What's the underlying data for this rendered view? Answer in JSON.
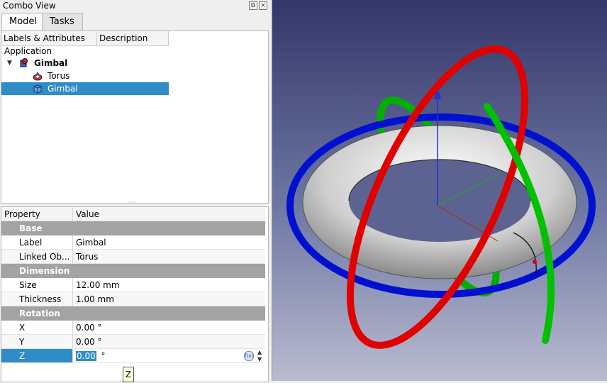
{
  "combo": {
    "title": "Combo View"
  },
  "tabs": [
    {
      "label": "Model"
    },
    {
      "label": "Tasks"
    }
  ],
  "tree": {
    "headers": {
      "labels": "Labels & Attributes",
      "description": "Description"
    },
    "application": "Application",
    "items": [
      {
        "label": "Gimbal",
        "icon": "part-icon"
      },
      {
        "label": "Torus",
        "icon": "torus-icon"
      },
      {
        "label": "Gimbal",
        "icon": "feature-icon"
      }
    ]
  },
  "props": {
    "headers": {
      "property": "Property",
      "value": "Value"
    },
    "groups": {
      "base": "Base",
      "dimension": "Dimension",
      "rotation": "Rotation"
    },
    "rows": {
      "label": {
        "name": "Label",
        "value": "Gimbal"
      },
      "linked": {
        "name": "Linked Ob...",
        "value": "Torus"
      },
      "size": {
        "name": "Size",
        "value": "12.00 mm"
      },
      "thickness": {
        "name": "Thickness",
        "value": "1.00 mm"
      },
      "x": {
        "name": "X",
        "value": "0.00 °"
      },
      "y": {
        "name": "Y",
        "value": "0.00 °"
      },
      "z": {
        "name": "Z",
        "value": "0.00",
        "unit": "°"
      }
    }
  },
  "tooltip": "Z",
  "colors": {
    "selection": "#308cc6",
    "ring_x": "#e00000",
    "ring_y": "#00c000",
    "ring_z": "#0010d0"
  }
}
